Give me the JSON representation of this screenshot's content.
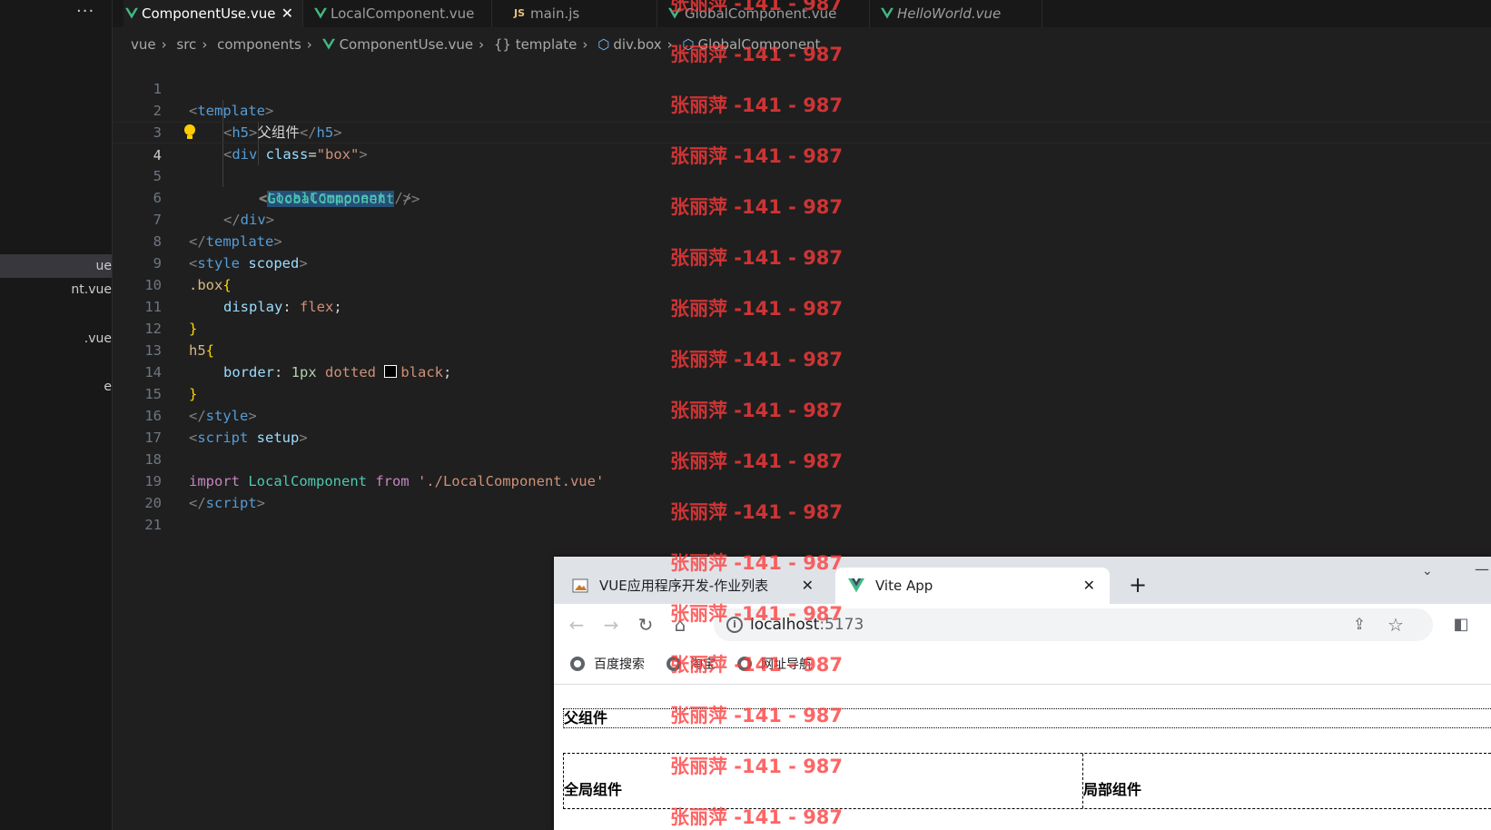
{
  "sidebar": {
    "more_label": "···",
    "files": [
      {
        "label": "ue",
        "active": true
      },
      {
        "label": "nt.vue",
        "active": false
      },
      {
        "label": ".vue",
        "active": false
      },
      {
        "label": "e",
        "active": false
      }
    ]
  },
  "tabs": [
    {
      "label": "ComponentUse.vue",
      "icon": "vue-icon",
      "active": true,
      "close": "✕"
    },
    {
      "label": "LocalComponent.vue",
      "icon": "vue-icon",
      "active": false
    },
    {
      "label": "main.js",
      "icon": "js-icon",
      "icon_text": "JS",
      "active": false
    },
    {
      "label": "GlobalComponent.vue",
      "icon": "vue-icon",
      "active": false
    },
    {
      "label": "HelloWorld.vue",
      "icon": "vue-icon",
      "active": false,
      "italic": true
    }
  ],
  "breadcrumb": {
    "items": [
      "vue",
      "src",
      "components",
      "ComponentUse.vue",
      "{} template",
      "div.box",
      "GlobalComponent"
    ]
  },
  "editor": {
    "current_line": "4",
    "lines": [
      "1",
      "2",
      "3",
      "4",
      "5",
      "6",
      "7",
      "8",
      "9",
      "10",
      "11",
      "12",
      "13",
      "14",
      "15",
      "16",
      "17",
      "18",
      "19",
      "20",
      "21"
    ]
  },
  "code": {
    "l1": {
      "open": "<",
      "tag": "template",
      "close": ">"
    },
    "l2": {
      "open": "<",
      "tag": "h5",
      "gt": ">",
      "text": "父组件",
      "lt_slash": "</",
      "tag2": "h5",
      "close": ">"
    },
    "l3": {
      "open": "<",
      "tag": "div",
      "attr": " class",
      "eq": "=",
      "str": "\"box\"",
      "close": ">"
    },
    "l4": {
      "open": "<",
      "comp": "GlobalComponent",
      "close": " />"
    },
    "l5": {
      "open": "<",
      "comp": "LocalComponent",
      "close": " />"
    },
    "l6": {
      "open": "</",
      "tag": "div",
      "close": ">"
    },
    "l7": {
      "open": "</",
      "tag": "template",
      "close": ">"
    },
    "l8": {
      "open": "<",
      "tag": "style",
      "attr": " scoped",
      "close": ">"
    },
    "l9": {
      "sel": ".box",
      "brace": "{"
    },
    "l10": {
      "prop": "display",
      "colon": ": ",
      "val": "flex",
      "semi": ";"
    },
    "l11": {
      "brace": "}"
    },
    "l12": {
      "sel": "h5",
      "brace": "{"
    },
    "l13": {
      "prop": "border",
      "colon": ": ",
      "num": "1px",
      "val1": " dotted ",
      "val2": "black",
      "semi": ";"
    },
    "l14": {
      "brace": "}"
    },
    "l15": {
      "open": "</",
      "tag": "style",
      "close": ">"
    },
    "l16": {
      "open": "<",
      "tag": "script",
      "attr": " setup",
      "close": ">"
    },
    "l18": {
      "kw": "import",
      "comp": " LocalComponent ",
      "kw2": "from",
      "str": " './LocalComponent.vue'"
    },
    "l19": {
      "open": "</",
      "tag": "script",
      "close": ">"
    }
  },
  "watermark": "张丽萍 -141 - 987",
  "browser": {
    "tabs": [
      {
        "label": "VUE应用程序开发-作业列表",
        "active": false,
        "close": "✕"
      },
      {
        "label": "Vite App",
        "active": true,
        "close": "✕"
      }
    ],
    "new_tab": "+",
    "url_host": "localhost",
    "url_port": ":5173",
    "bookmarks": [
      "百度搜索",
      "淘宝",
      "网址导航"
    ],
    "page": {
      "parent_heading": "父组件",
      "global_component": "全局组件",
      "local_component": "局部组件"
    }
  }
}
